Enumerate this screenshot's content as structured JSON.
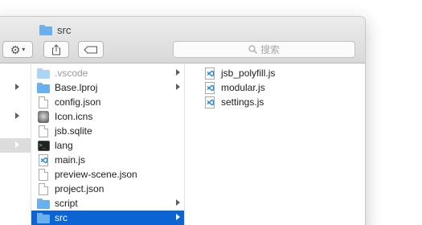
{
  "window": {
    "title": "src"
  },
  "toolbar": {
    "search_placeholder": "搜索"
  },
  "columns": {
    "left": {
      "rows": [
        {
          "arrow": true
        },
        {
          "arrow": true
        },
        {
          "arrow": true,
          "selected": true
        }
      ]
    },
    "middle": {
      "items": [
        {
          "name": ".vscode",
          "icon": "folder-icon",
          "arrow": true,
          "dim": true
        },
        {
          "name": "Base.lproj",
          "icon": "folder-icon",
          "arrow": true
        },
        {
          "name": "config.json",
          "icon": "document-icon"
        },
        {
          "name": "Icon.icns",
          "icon": "icns-icon"
        },
        {
          "name": "jsb.sqlite",
          "icon": "document-icon"
        },
        {
          "name": "lang",
          "icon": "terminal-icon"
        },
        {
          "name": "main.js",
          "icon": "vscode-js-icon"
        },
        {
          "name": "preview-scene.json",
          "icon": "document-icon"
        },
        {
          "name": "project.json",
          "icon": "document-icon"
        },
        {
          "name": "script",
          "icon": "folder-icon",
          "arrow": true
        },
        {
          "name": "src",
          "icon": "folder-icon",
          "arrow": true,
          "selected": true
        }
      ]
    },
    "right": {
      "items": [
        {
          "name": "jsb_polyfill.js",
          "icon": "vscode-js-icon"
        },
        {
          "name": "modular.js",
          "icon": "vscode-js-icon"
        },
        {
          "name": "settings.js",
          "icon": "vscode-js-icon"
        }
      ]
    }
  },
  "colors": {
    "selection": "#0b64d4",
    "folder": "#69b1ee",
    "vscode_blue": "#1f86d6"
  }
}
